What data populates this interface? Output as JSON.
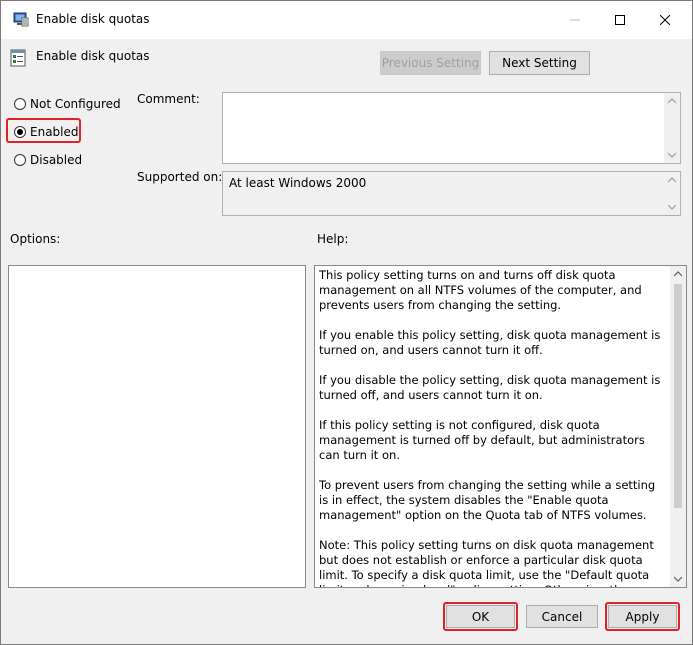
{
  "window": {
    "title": "Enable disk quotas",
    "icon": "policy-computer-icon"
  },
  "header": {
    "policy_name": "Enable disk quotas",
    "prev_button": "Previous Setting",
    "next_button": "Next Setting"
  },
  "state": {
    "options": [
      {
        "label": "Not Configured",
        "checked": false
      },
      {
        "label": "Enabled",
        "checked": true
      },
      {
        "label": "Disabled",
        "checked": false
      }
    ]
  },
  "fields": {
    "comment_label": "Comment:",
    "comment_value": "",
    "supported_label": "Supported on:",
    "supported_value": "At least Windows 2000"
  },
  "panels": {
    "options_label": "Options:",
    "help_label": "Help:",
    "help_paragraphs": [
      "This policy setting turns on and turns off disk quota management on all NTFS volumes of the computer, and prevents users from changing the setting.",
      "If you enable this policy setting, disk quota management is turned on, and users cannot turn it off.",
      "If you disable the policy setting, disk quota management is turned off, and users cannot turn it on.",
      "If this policy setting is not configured, disk quota management is turned off by default, but administrators can turn it on.",
      "To prevent users from changing the setting while a setting is in effect, the system disables the \"Enable quota management\" option on the Quota tab of NTFS volumes.",
      "Note: This policy setting turns on disk quota management but does not establish or enforce a particular disk quota limit. To specify a disk quota limit, use the \"Default quota limit and warning level\" policy setting. Otherwise, the system uses the physical space on the volume as the quota limit."
    ]
  },
  "footer": {
    "ok": "OK",
    "cancel": "Cancel",
    "apply": "Apply"
  },
  "colors": {
    "highlight": "#e0232b"
  }
}
